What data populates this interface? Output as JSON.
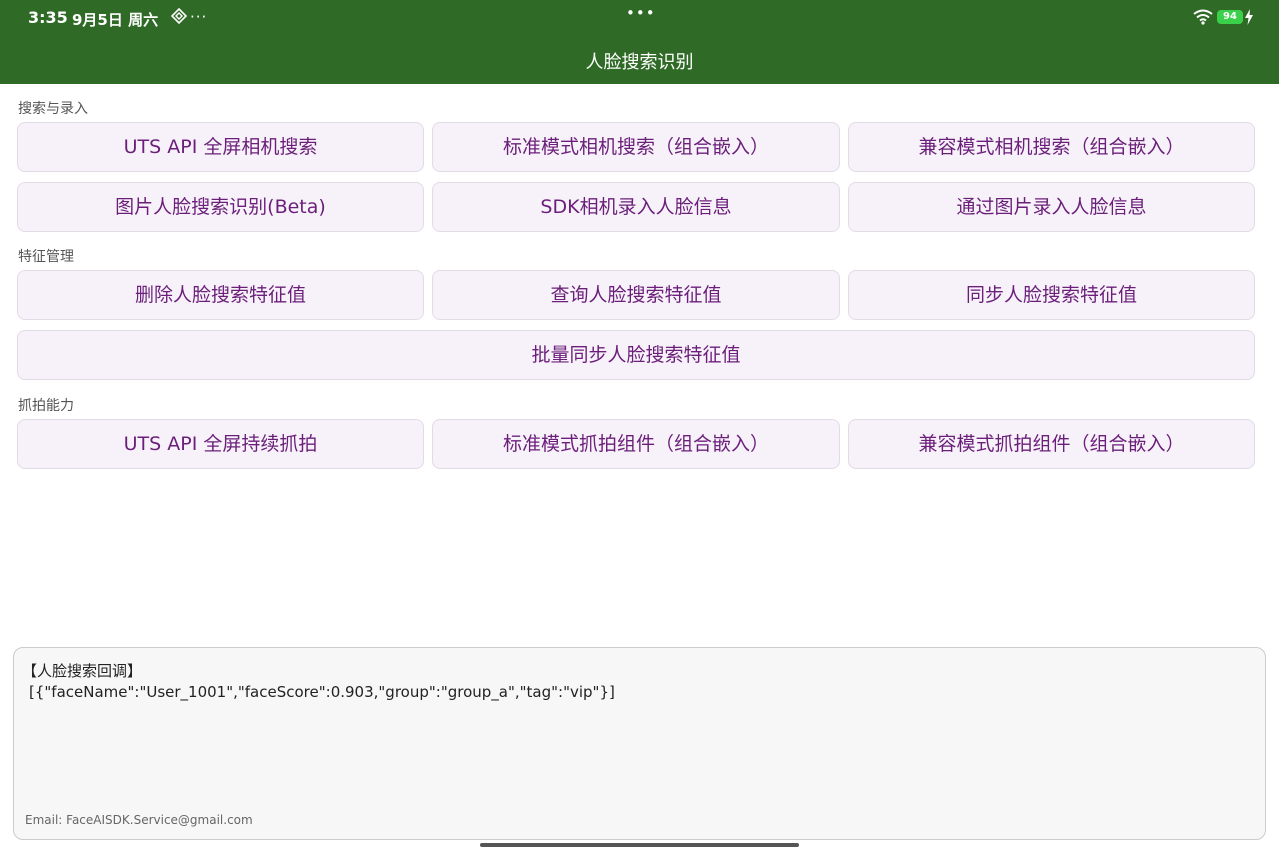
{
  "status_bar": {
    "time": "3:35",
    "date": "9月5日 周六",
    "more": "···",
    "center_dots": "•••",
    "battery": "94"
  },
  "header": {
    "title": "人脸搜索识别",
    "background": "#2f6b26"
  },
  "sections": {
    "search": {
      "label": "搜索与录入",
      "buttons": [
        "UTS API 全屏相机搜索",
        "标准模式相机搜索（组合嵌入）",
        "兼容模式相机搜索（组合嵌入）",
        "图片人脸搜索识别(Beta)",
        "SDK相机录入人脸信息",
        "通过图片录入人脸信息"
      ]
    },
    "features": {
      "label": "特征管理",
      "buttons": [
        "删除人脸搜索特征值",
        "查询人脸搜索特征值",
        "同步人脸搜索特征值",
        "批量同步人脸搜索特征值"
      ]
    },
    "capture": {
      "label": "抓拍能力",
      "buttons": [
        "UTS API 全屏持续抓拍",
        "标准模式抓拍组件（组合嵌入）",
        "兼容模式抓拍组件（组合嵌入）"
      ]
    }
  },
  "result": {
    "title": "【人脸搜索回调】",
    "json": "[{\"faceName\":\"User_1001\",\"faceScore\":0.903,\"group\":\"group_a\",\"tag\":\"vip\"}]",
    "email": "Email: FaceAISDK.Service@gmail.com"
  },
  "colors": {
    "button_text": "#6b1f7a",
    "button_bg": "#f7f2f9",
    "battery": "#3ad04a"
  }
}
